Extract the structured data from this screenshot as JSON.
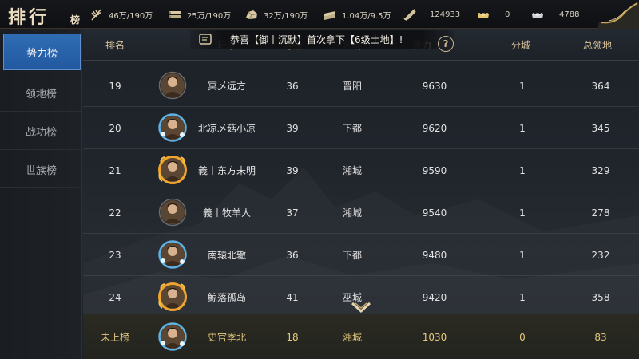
{
  "title": {
    "main": "排行",
    "sub": "榜"
  },
  "resources": [
    {
      "icon": "wheat-icon",
      "value": "46万/190万"
    },
    {
      "icon": "wood-icon",
      "value": "25万/190万"
    },
    {
      "icon": "stone-icon",
      "value": "32万/190万"
    },
    {
      "icon": "iron-icon",
      "value": "1.04万/9.5万"
    },
    {
      "icon": "copper-icon",
      "value": "124933"
    },
    {
      "icon": "gold-ingot-icon",
      "value": "0"
    },
    {
      "icon": "silver-ingot-icon",
      "value": "4788"
    }
  ],
  "sidebar": {
    "items": [
      {
        "label": "势力榜",
        "active": true
      },
      {
        "label": "领地榜",
        "active": false
      },
      {
        "label": "战功榜",
        "active": false
      },
      {
        "label": "世族榜",
        "active": false
      }
    ]
  },
  "table": {
    "headers": {
      "rank": "排名",
      "player": "玩家",
      "level": "等级",
      "region": "区域",
      "power": "势力",
      "cities": "分城",
      "territory": "总领地"
    }
  },
  "announcement": "恭喜【御丨沉默】首次拿下【6级土地】!",
  "rows": [
    {
      "rank": "19",
      "name": "冥乄远方",
      "level": "36",
      "region": "晋阳",
      "power": "9630",
      "cities": "1",
      "territory": "364",
      "avatar_frame": "plain"
    },
    {
      "rank": "20",
      "name": "北凉乄菇小凉",
      "level": "39",
      "region": "下都",
      "power": "9620",
      "cities": "1",
      "territory": "345",
      "avatar_frame": "blue"
    },
    {
      "rank": "21",
      "name": "義丨东方未明",
      "level": "39",
      "region": "湘城",
      "power": "9590",
      "cities": "1",
      "territory": "329",
      "avatar_frame": "fire"
    },
    {
      "rank": "22",
      "name": "義丨牧羊人",
      "level": "37",
      "region": "湘城",
      "power": "9540",
      "cities": "1",
      "territory": "278",
      "avatar_frame": "plain"
    },
    {
      "rank": "23",
      "name": "南辕北辙",
      "level": "36",
      "region": "下都",
      "power": "9480",
      "cities": "1",
      "territory": "232",
      "avatar_frame": "blue"
    },
    {
      "rank": "24",
      "name": "鲸落孤岛",
      "level": "41",
      "region": "巫城",
      "power": "9420",
      "cities": "1",
      "territory": "358",
      "avatar_frame": "fire"
    }
  ],
  "my_rank": {
    "rank": "未上榜",
    "name": "史官季北",
    "level": "18",
    "region": "湘城",
    "power": "1030",
    "cities": "0",
    "territory": "83",
    "avatar_frame": "blue"
  },
  "colors": {
    "header_gold": "#d8c29a",
    "active_tab": "#2f6db3",
    "my_rank_gold": "#e5c87c"
  }
}
